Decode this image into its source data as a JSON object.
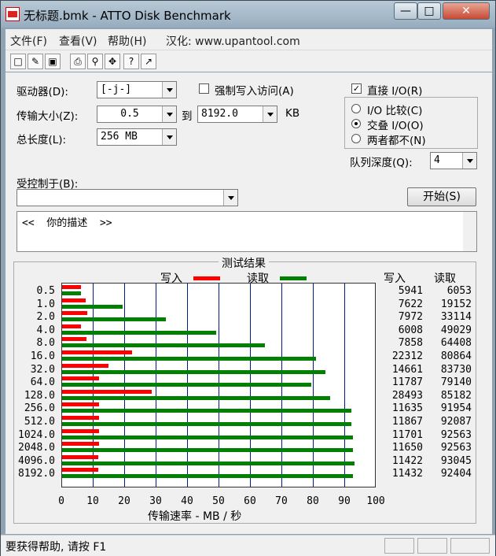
{
  "window": {
    "title": "无标题.bmk - ATTO Disk Benchmark"
  },
  "menu": {
    "file": "文件(F)",
    "view": "查看(V)",
    "help": "帮助(H)",
    "credit": "汉化: www.upantool.com"
  },
  "toolbar": {
    "icons": [
      "new-file-icon",
      "open-folder-icon",
      "save-icon",
      "print-icon",
      "print-preview-icon",
      "move-icon",
      "help-icon",
      "context-help-icon"
    ]
  },
  "controls": {
    "drive_label": "驱动器(D):",
    "drive_value": "[-j-]",
    "force_write_label": "强制写入访问(A)",
    "direct_io_label": "直接 I/O(R)",
    "direct_io_checked": true,
    "transfer_size_label": "传输大小(Z):",
    "transfer_min": "0.5",
    "to_label": "到",
    "transfer_max": "8192.0",
    "kb_label": "KB",
    "total_length_label": "总长度(L):",
    "total_length_value": "256 MB",
    "io_compare_label": "I/O 比较(C)",
    "overlapped_io_label": "交叠 I/O(O)",
    "neither_label": "两者都不(N)",
    "selected_io_mode": "交叠 I/O(O)",
    "queue_depth_label": "队列深度(Q):",
    "queue_depth_value": "4",
    "controlled_by_label": "受控制于(B):",
    "controlled_by_value": "",
    "start_button": "开始(S)",
    "description": "<<  你的描述  >>"
  },
  "chart_data": {
    "type": "bar",
    "title": "测试结果",
    "orientation": "horizontal",
    "categories": [
      "0.5",
      "1.0",
      "2.0",
      "4.0",
      "8.0",
      "16.0",
      "32.0",
      "64.0",
      "128.0",
      "256.0",
      "512.0",
      "1024.0",
      "2048.0",
      "4096.0",
      "8192.0"
    ],
    "series": [
      {
        "name": "写入",
        "color": "#ff0000",
        "values": [
          5941,
          7622,
          7972,
          6008,
          7858,
          22312,
          14661,
          11787,
          28493,
          11635,
          11867,
          11701,
          11650,
          11422,
          11432
        ]
      },
      {
        "name": "读取",
        "color": "#008000",
        "values": [
          6053,
          19152,
          33114,
          49029,
          64408,
          80864,
          83730,
          79140,
          85182,
          91954,
          92087,
          92563,
          92563,
          93045,
          92404
        ]
      }
    ],
    "column_headers": [
      "写入",
      "读取"
    ],
    "xlabel": "传输速率 - MB / 秒",
    "x_ticks": [
      "0",
      "10",
      "20",
      "30",
      "40",
      "50",
      "60",
      "70",
      "80",
      "90",
      "100"
    ],
    "xlim": [
      0,
      100
    ],
    "value_unit_divisor": 1000,
    "grid": true
  },
  "status": {
    "text": "要获得帮助, 请按 F1"
  }
}
